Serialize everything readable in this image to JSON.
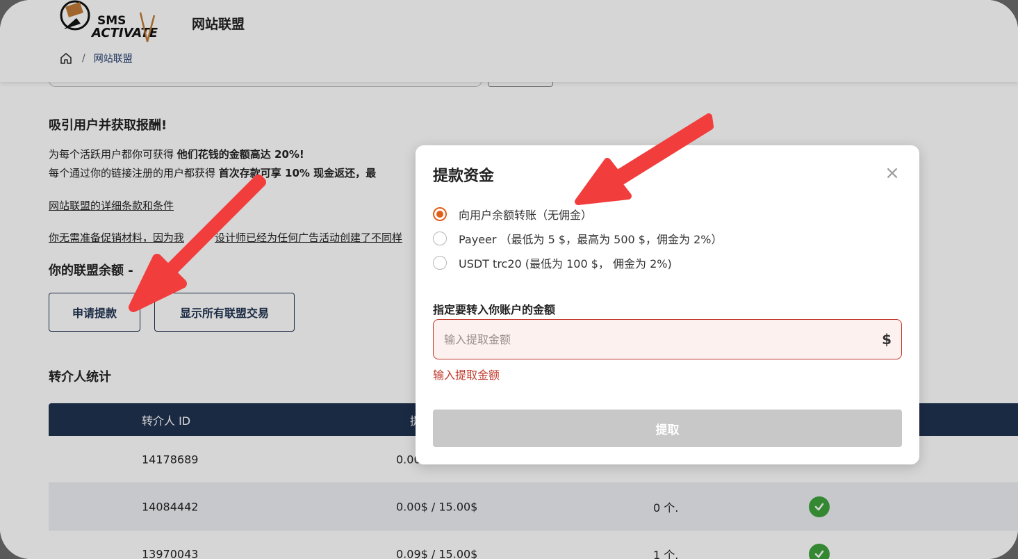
{
  "header": {
    "logo_text_top": "SMS",
    "logo_text_bottom": "ACTIVATE",
    "title": "网站联盟"
  },
  "breadcrumb": {
    "home_icon": "home-icon",
    "separator": "/",
    "current": "网站联盟"
  },
  "content": {
    "attract_heading": "吸引用户并获取报酬!",
    "line1_prefix": "为每个活跃用户都你可获得 ",
    "line1_bold": "他们花钱的金额高达 20%!",
    "line2_prefix": "每个通过你的链接注册的用户都获得 ",
    "line2_bold": "首次存款可享 10% 现金返还，最",
    "terms_link": "网站联盟的详细条款和条件",
    "promo_link_start": "你无需准备促销材料，因为我",
    "promo_link_end": "设计师已经为任何广告活动创建了不同样",
    "balance_heading": "你的联盟余额 -",
    "apply_button": "申请提款",
    "show_all_button": "显示所有联盟交易",
    "stats_heading": "转介人统计"
  },
  "table": {
    "headers": [
      "转介人 ID",
      "提"
    ],
    "rows": [
      {
        "id": "14178689",
        "amount": "0.00",
        "count": "",
        "active": true
      },
      {
        "id": "14084442",
        "amount": "0.00$ / 15.00$",
        "count": "0 个.",
        "active": true
      },
      {
        "id": "13970043",
        "amount": "0.09$ / 15.00$",
        "count": "1 个.",
        "active": true
      }
    ]
  },
  "modal": {
    "title": "提款资金",
    "close_symbol": "×",
    "options": [
      {
        "label": "向用户余额转账（无佣金）",
        "checked": true
      },
      {
        "label": "Payeer （最低为 5 $，最高为 500 $，佣金为 2%）",
        "checked": false
      },
      {
        "label": "USDT trc20 (最低为 100 $， 佣金为 2%)",
        "checked": false
      }
    ],
    "amount_label": "指定要转入你账户的金额",
    "amount_placeholder": "输入提取金额",
    "amount_value": "",
    "currency_symbol": "$",
    "error_text": "输入提取金额",
    "submit_label": "提取"
  },
  "colors": {
    "navy": "#1f3350",
    "accent_orange": "#e0601a",
    "error_red": "#c0392b",
    "success_green": "#3fa33b",
    "arrow_red": "#f23d3d",
    "disabled_gray": "#c8c8c8"
  }
}
